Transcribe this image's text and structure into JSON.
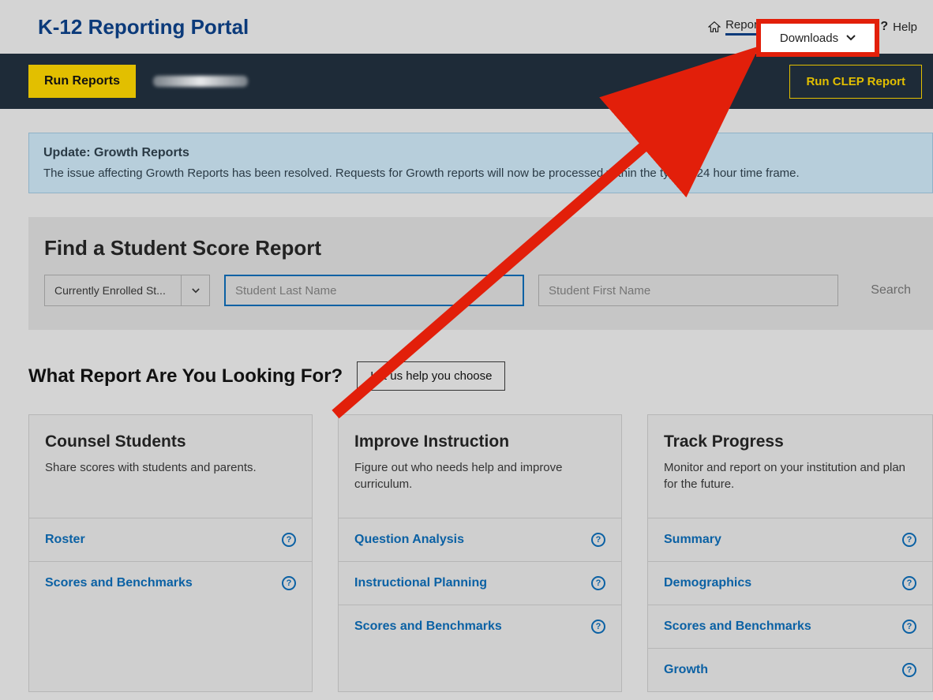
{
  "brand": "K-12 Reporting Portal",
  "topnav": {
    "reports": "Reports",
    "downloads": "Downloads",
    "help": "Help"
  },
  "darkbar": {
    "run_reports": "Run Reports",
    "run_clep": "Run CLEP Report"
  },
  "banner": {
    "title": "Update: Growth Reports",
    "body": "The issue affecting Growth Reports has been resolved. Requests for Growth reports will now be processed within the typical 24 hour time frame."
  },
  "find": {
    "heading": "Find a Student Score Report",
    "enroll_select": "Currently Enrolled St...",
    "lastname_ph": "Student Last Name",
    "firstname_ph": "Student First Name",
    "search": "Search"
  },
  "what_report": {
    "heading": "What Report Are You Looking For?",
    "help_btn": "Let us help you choose"
  },
  "cards": [
    {
      "title": "Counsel Students",
      "desc": "Share scores with students and parents.",
      "links": [
        "Roster",
        "Scores and Benchmarks"
      ]
    },
    {
      "title": "Improve Instruction",
      "desc": "Figure out who needs help and improve curriculum.",
      "links": [
        "Question Analysis",
        "Instructional Planning",
        "Scores and Benchmarks"
      ]
    },
    {
      "title": "Track Progress",
      "desc": "Monitor and report on your institution and plan for the future.",
      "links": [
        "Summary",
        "Demographics",
        "Scores and Benchmarks",
        "Growth"
      ]
    }
  ]
}
